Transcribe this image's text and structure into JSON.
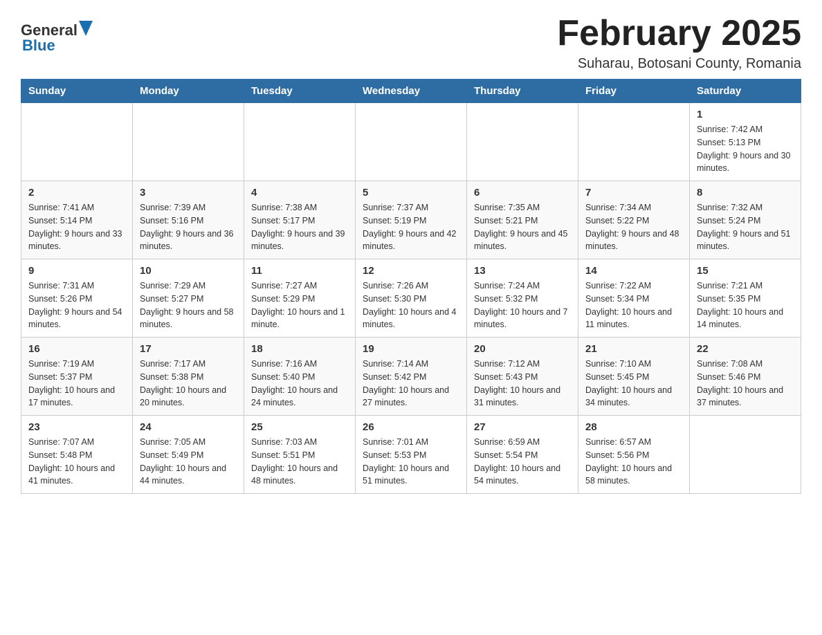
{
  "header": {
    "logo_general": "General",
    "logo_blue": "Blue",
    "month_title": "February 2025",
    "location": "Suharau, Botosani County, Romania"
  },
  "days_of_week": [
    "Sunday",
    "Monday",
    "Tuesday",
    "Wednesday",
    "Thursday",
    "Friday",
    "Saturday"
  ],
  "weeks": [
    [
      {
        "day": "",
        "info": ""
      },
      {
        "day": "",
        "info": ""
      },
      {
        "day": "",
        "info": ""
      },
      {
        "day": "",
        "info": ""
      },
      {
        "day": "",
        "info": ""
      },
      {
        "day": "",
        "info": ""
      },
      {
        "day": "1",
        "info": "Sunrise: 7:42 AM\nSunset: 5:13 PM\nDaylight: 9 hours and 30 minutes."
      }
    ],
    [
      {
        "day": "2",
        "info": "Sunrise: 7:41 AM\nSunset: 5:14 PM\nDaylight: 9 hours and 33 minutes."
      },
      {
        "day": "3",
        "info": "Sunrise: 7:39 AM\nSunset: 5:16 PM\nDaylight: 9 hours and 36 minutes."
      },
      {
        "day": "4",
        "info": "Sunrise: 7:38 AM\nSunset: 5:17 PM\nDaylight: 9 hours and 39 minutes."
      },
      {
        "day": "5",
        "info": "Sunrise: 7:37 AM\nSunset: 5:19 PM\nDaylight: 9 hours and 42 minutes."
      },
      {
        "day": "6",
        "info": "Sunrise: 7:35 AM\nSunset: 5:21 PM\nDaylight: 9 hours and 45 minutes."
      },
      {
        "day": "7",
        "info": "Sunrise: 7:34 AM\nSunset: 5:22 PM\nDaylight: 9 hours and 48 minutes."
      },
      {
        "day": "8",
        "info": "Sunrise: 7:32 AM\nSunset: 5:24 PM\nDaylight: 9 hours and 51 minutes."
      }
    ],
    [
      {
        "day": "9",
        "info": "Sunrise: 7:31 AM\nSunset: 5:26 PM\nDaylight: 9 hours and 54 minutes."
      },
      {
        "day": "10",
        "info": "Sunrise: 7:29 AM\nSunset: 5:27 PM\nDaylight: 9 hours and 58 minutes."
      },
      {
        "day": "11",
        "info": "Sunrise: 7:27 AM\nSunset: 5:29 PM\nDaylight: 10 hours and 1 minute."
      },
      {
        "day": "12",
        "info": "Sunrise: 7:26 AM\nSunset: 5:30 PM\nDaylight: 10 hours and 4 minutes."
      },
      {
        "day": "13",
        "info": "Sunrise: 7:24 AM\nSunset: 5:32 PM\nDaylight: 10 hours and 7 minutes."
      },
      {
        "day": "14",
        "info": "Sunrise: 7:22 AM\nSunset: 5:34 PM\nDaylight: 10 hours and 11 minutes."
      },
      {
        "day": "15",
        "info": "Sunrise: 7:21 AM\nSunset: 5:35 PM\nDaylight: 10 hours and 14 minutes."
      }
    ],
    [
      {
        "day": "16",
        "info": "Sunrise: 7:19 AM\nSunset: 5:37 PM\nDaylight: 10 hours and 17 minutes."
      },
      {
        "day": "17",
        "info": "Sunrise: 7:17 AM\nSunset: 5:38 PM\nDaylight: 10 hours and 20 minutes."
      },
      {
        "day": "18",
        "info": "Sunrise: 7:16 AM\nSunset: 5:40 PM\nDaylight: 10 hours and 24 minutes."
      },
      {
        "day": "19",
        "info": "Sunrise: 7:14 AM\nSunset: 5:42 PM\nDaylight: 10 hours and 27 minutes."
      },
      {
        "day": "20",
        "info": "Sunrise: 7:12 AM\nSunset: 5:43 PM\nDaylight: 10 hours and 31 minutes."
      },
      {
        "day": "21",
        "info": "Sunrise: 7:10 AM\nSunset: 5:45 PM\nDaylight: 10 hours and 34 minutes."
      },
      {
        "day": "22",
        "info": "Sunrise: 7:08 AM\nSunset: 5:46 PM\nDaylight: 10 hours and 37 minutes."
      }
    ],
    [
      {
        "day": "23",
        "info": "Sunrise: 7:07 AM\nSunset: 5:48 PM\nDaylight: 10 hours and 41 minutes."
      },
      {
        "day": "24",
        "info": "Sunrise: 7:05 AM\nSunset: 5:49 PM\nDaylight: 10 hours and 44 minutes."
      },
      {
        "day": "25",
        "info": "Sunrise: 7:03 AM\nSunset: 5:51 PM\nDaylight: 10 hours and 48 minutes."
      },
      {
        "day": "26",
        "info": "Sunrise: 7:01 AM\nSunset: 5:53 PM\nDaylight: 10 hours and 51 minutes."
      },
      {
        "day": "27",
        "info": "Sunrise: 6:59 AM\nSunset: 5:54 PM\nDaylight: 10 hours and 54 minutes."
      },
      {
        "day": "28",
        "info": "Sunrise: 6:57 AM\nSunset: 5:56 PM\nDaylight: 10 hours and 58 minutes."
      },
      {
        "day": "",
        "info": ""
      }
    ]
  ]
}
